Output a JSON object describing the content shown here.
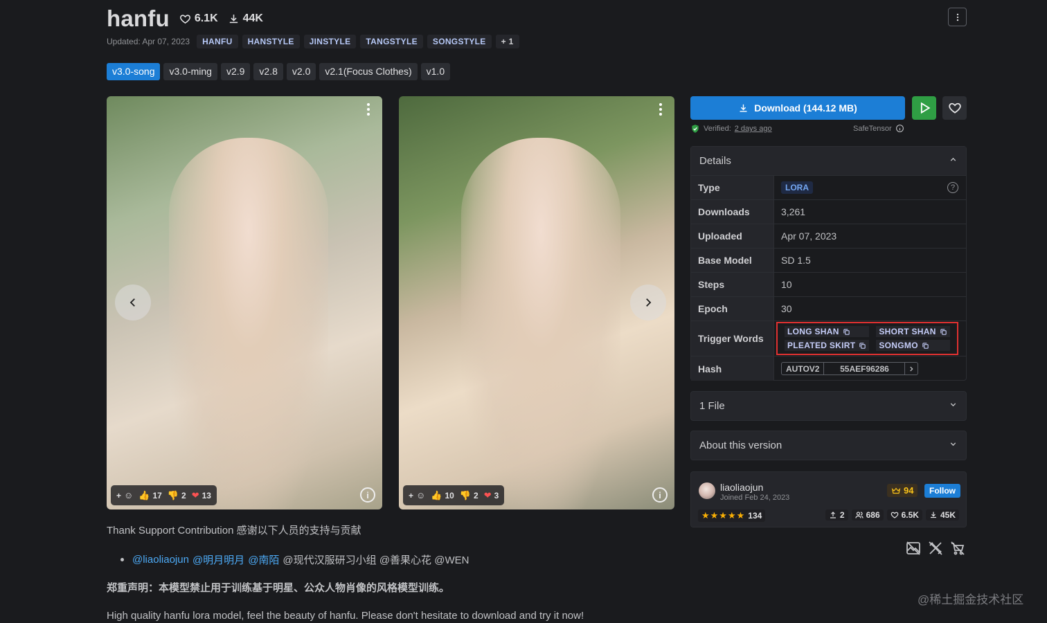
{
  "header": {
    "title": "hanfu",
    "likes": "6.1K",
    "downloads": "44K",
    "updated": "Updated: Apr 07, 2023",
    "tags": [
      "HANFU",
      "HANSTYLE",
      "JINSTYLE",
      "TANGSTYLE",
      "SONGSTYLE"
    ],
    "more_tags": "+ 1"
  },
  "versions": [
    "v3.0-song",
    "v3.0-ming",
    "v2.9",
    "v2.8",
    "v2.0",
    "v2.1(Focus Clothes)",
    "v1.0"
  ],
  "active_version": "v3.0-song",
  "gallery": [
    {
      "likes": "17",
      "dislikes": "2",
      "hearts": "13"
    },
    {
      "likes": "10",
      "dislikes": "2",
      "hearts": "3"
    }
  ],
  "download": {
    "label": "Download (144.12 MB)",
    "verified_label": "Verified:",
    "verified_when": "2 days ago",
    "format": "SafeTensor"
  },
  "details": {
    "title": "Details",
    "rows": {
      "type_label": "Type",
      "type_value": "LORA",
      "downloads_label": "Downloads",
      "downloads_value": "3,261",
      "uploaded_label": "Uploaded",
      "uploaded_value": "Apr 07, 2023",
      "base_label": "Base Model",
      "base_value": "SD 1.5",
      "steps_label": "Steps",
      "steps_value": "10",
      "epoch_label": "Epoch",
      "epoch_value": "30",
      "trigger_label": "Trigger Words",
      "hash_label": "Hash",
      "hash_type": "AUTOV2",
      "hash_value": "55AEF96286"
    },
    "trigger_words": [
      "LONG SHAN",
      "SHORT SHAN",
      "PLEATED SKIRT",
      "SONGMO"
    ]
  },
  "accordions": {
    "files": "1 File",
    "about": "About this version"
  },
  "creator": {
    "name": "liaoliaojun",
    "joined": "Joined Feb 24, 2023",
    "rank": "94",
    "follow": "Follow",
    "rating_count": "134",
    "uploads": "2",
    "followers": "686",
    "favorites": "6.5K",
    "downloads": "45K"
  },
  "description": {
    "line1": "Thank Support Contribution 感谢以下人员的支持与贡献",
    "links": [
      "@liaoliaojun",
      "@明月明月",
      "@南陌"
    ],
    "rest": "@现代汉服研习小组 @善果心花 @WEN",
    "bold": "郑重声明：本模型禁止用于训练基于明星、公众人物肖像的风格模型训练。",
    "last": "High quality hanfu lora model, feel the beauty of hanfu. Please don't hesitate to download and try it now!"
  },
  "watermark": "@稀土掘金技术社区",
  "colors": {
    "background": "#1a1b1e",
    "accent": "#1c7ed6",
    "play": "#2f9e44",
    "highlight": "#e03131"
  }
}
